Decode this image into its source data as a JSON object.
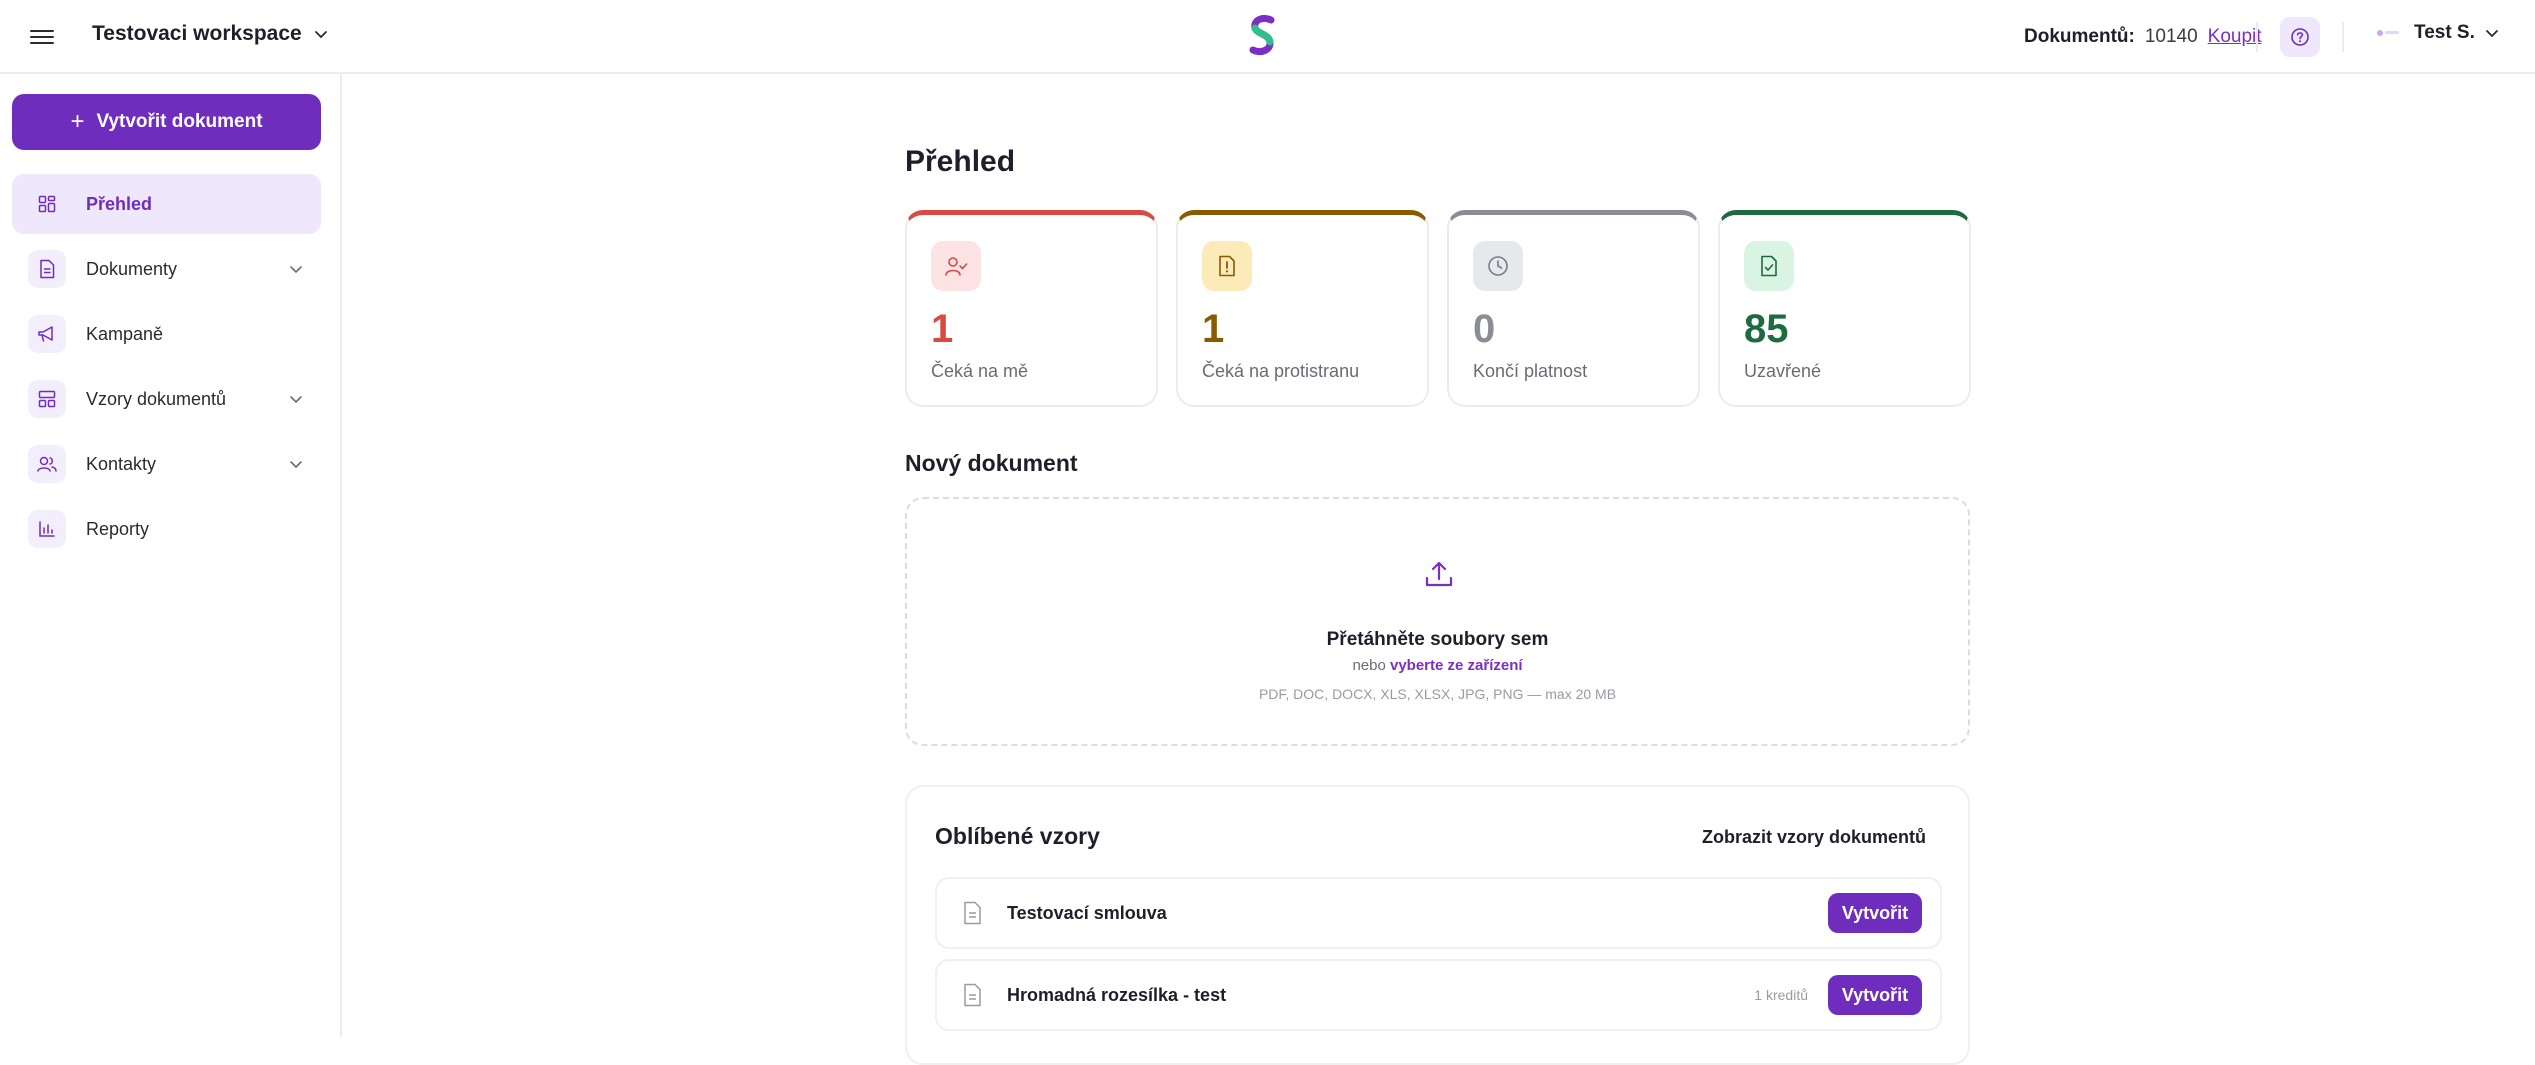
{
  "header": {
    "workspace": "Testovaci workspace",
    "docs_label": "Dokumentů:",
    "docs_count": "10140",
    "buy_label": "Koupit",
    "user_name": "Test S."
  },
  "sidebar": {
    "create_label": "Vytvořit dokument",
    "items": [
      {
        "label": "Přehled",
        "icon": "grid-icon",
        "active": true
      },
      {
        "label": "Dokumenty",
        "icon": "document-icon",
        "has_children": true
      },
      {
        "label": "Kampaně",
        "icon": "megaphone-icon"
      },
      {
        "label": "Vzory dokumentů",
        "icon": "template-icon",
        "has_children": true
      },
      {
        "label": "Kontakty",
        "icon": "users-icon",
        "has_children": true
      },
      {
        "label": "Reporty",
        "icon": "chart-icon"
      }
    ]
  },
  "main": {
    "title": "Přehled",
    "cards": [
      {
        "value": "1",
        "label": "Čeká na mě",
        "color": "#d94a45",
        "bg": "#fde3e3",
        "icon": "user-check-icon"
      },
      {
        "value": "1",
        "label": "Čeká na protistranu",
        "color": "#8a5a00",
        "bg": "#fcebb8",
        "icon": "alert-file-icon"
      },
      {
        "value": "0",
        "label": "Končí platnost",
        "color": "#8a8d94",
        "bg": "#e6e8ec",
        "icon": "clock-icon"
      },
      {
        "value": "85",
        "label": "Uzavřené",
        "color": "#1e6b3f",
        "bg": "#d9f4e2",
        "icon": "file-check-icon"
      }
    ],
    "new_doc_title": "Nový dokument",
    "dropzone": {
      "title": "Přetáhněte soubory sem",
      "or": "nebo",
      "link": "vyberte ze zařízení",
      "formats": "PDF, DOC, DOCX, XLS, XLSX, JPG, PNG — max 20 MB"
    },
    "favorites": {
      "title": "Oblíbené vzory",
      "view_all": "Zobrazit vzory dokumentů",
      "rows": [
        {
          "name": "Testovací smlouva",
          "credits": "",
          "action": "Vytvořit"
        },
        {
          "name": "Hromadná rozesílka - test",
          "credits": "1 kreditů",
          "action": "Vytvořit"
        }
      ]
    }
  },
  "colors": {
    "accent": "#6f2dbd",
    "accent_light": "#efe7fb"
  }
}
